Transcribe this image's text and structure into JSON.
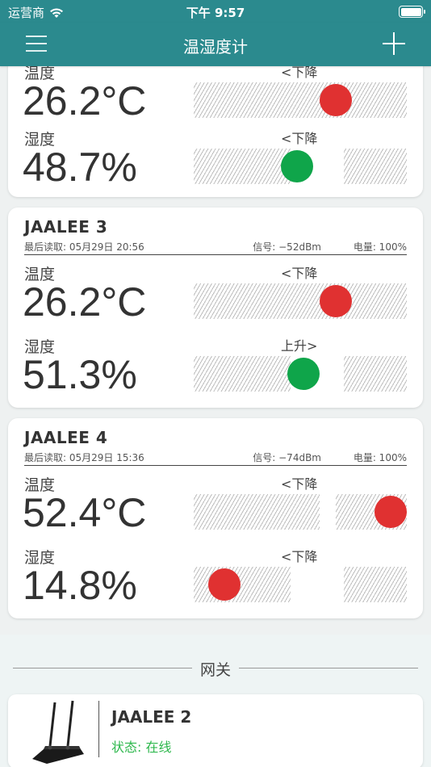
{
  "status_bar": {
    "carrier": "运营商",
    "time": "下午 9:57"
  },
  "nav": {
    "title": "温湿度计",
    "menu_icon": "hamburger-menu-icon",
    "add_icon": "plus-icon"
  },
  "colors": {
    "header": "#2b8a8e",
    "red": "#e03131",
    "green": "#0fa54a",
    "online": "#2fb84e"
  },
  "cards": [
    {
      "name": "",
      "last_read": "",
      "signal": "",
      "power": "",
      "temperature": {
        "label": "温度",
        "value": "26.2°C",
        "trend": "<下降",
        "indicator": "red"
      },
      "humidity": {
        "label": "湿度",
        "value": "48.7%",
        "trend": "<下降",
        "indicator": "green"
      }
    },
    {
      "name": "JAALEE 3",
      "last_read": "最后读取: 05月29日 20:56",
      "signal": "信号: −52dBm",
      "power": "电量: 100%",
      "temperature": {
        "label": "温度",
        "value": "26.2°C",
        "trend": "<下降",
        "indicator": "red"
      },
      "humidity": {
        "label": "湿度",
        "value": "51.3%",
        "trend": "上升>",
        "indicator": "green"
      }
    },
    {
      "name": "JAALEE 4",
      "last_read": "最后读取: 05月29日 15:36",
      "signal": "信号: −74dBm",
      "power": "电量: 100%",
      "temperature": {
        "label": "温度",
        "value": "52.4°C",
        "trend": "<下降",
        "indicator": "red"
      },
      "humidity": {
        "label": "湿度",
        "value": "14.8%",
        "trend": "<下降",
        "indicator": "red"
      }
    }
  ],
  "gateway": {
    "section_title": "网关",
    "device_name": "JAALEE 2",
    "status": "状态: 在线"
  }
}
